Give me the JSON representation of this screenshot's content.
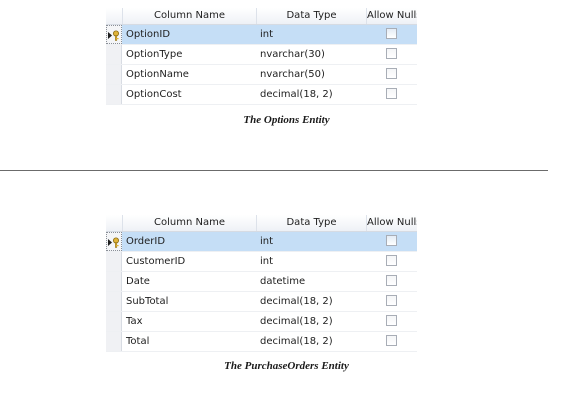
{
  "tables": [
    {
      "headers": {
        "column_name": "Column Name",
        "data_type": "Data Type",
        "allow_nulls": "Allow Nulls"
      },
      "rows": [
        {
          "name": "OptionID",
          "type": "int",
          "allow_nulls": false,
          "primary_key": true,
          "selected": true
        },
        {
          "name": "OptionType",
          "type": "nvarchar(30)",
          "allow_nulls": false,
          "primary_key": false,
          "selected": false
        },
        {
          "name": "OptionName",
          "type": "nvarchar(50)",
          "allow_nulls": false,
          "primary_key": false,
          "selected": false
        },
        {
          "name": "OptionCost",
          "type": "decimal(18, 2)",
          "allow_nulls": false,
          "primary_key": false,
          "selected": false
        }
      ],
      "caption": "The Options Entity"
    },
    {
      "headers": {
        "column_name": "Column Name",
        "data_type": "Data Type",
        "allow_nulls": "Allow Nulls"
      },
      "rows": [
        {
          "name": "OrderID",
          "type": "int",
          "allow_nulls": false,
          "primary_key": true,
          "selected": true
        },
        {
          "name": "CustomerID",
          "type": "int",
          "allow_nulls": false,
          "primary_key": false,
          "selected": false
        },
        {
          "name": "Date",
          "type": "datetime",
          "allow_nulls": false,
          "primary_key": false,
          "selected": false
        },
        {
          "name": "SubTotal",
          "type": "decimal(18, 2)",
          "allow_nulls": false,
          "primary_key": false,
          "selected": false
        },
        {
          "name": "Tax",
          "type": "decimal(18, 2)",
          "allow_nulls": false,
          "primary_key": false,
          "selected": false
        },
        {
          "name": "Total",
          "type": "decimal(18, 2)",
          "allow_nulls": false,
          "primary_key": false,
          "selected": false
        }
      ],
      "caption": "The PurchaseOrders Entity"
    }
  ],
  "icons": {
    "primary_key_indicator": "current-row-primary-key-icon"
  },
  "colors": {
    "selected_row": "#c5def6",
    "key_gold": "#e0b43a",
    "separator": "#6b6b6b"
  }
}
